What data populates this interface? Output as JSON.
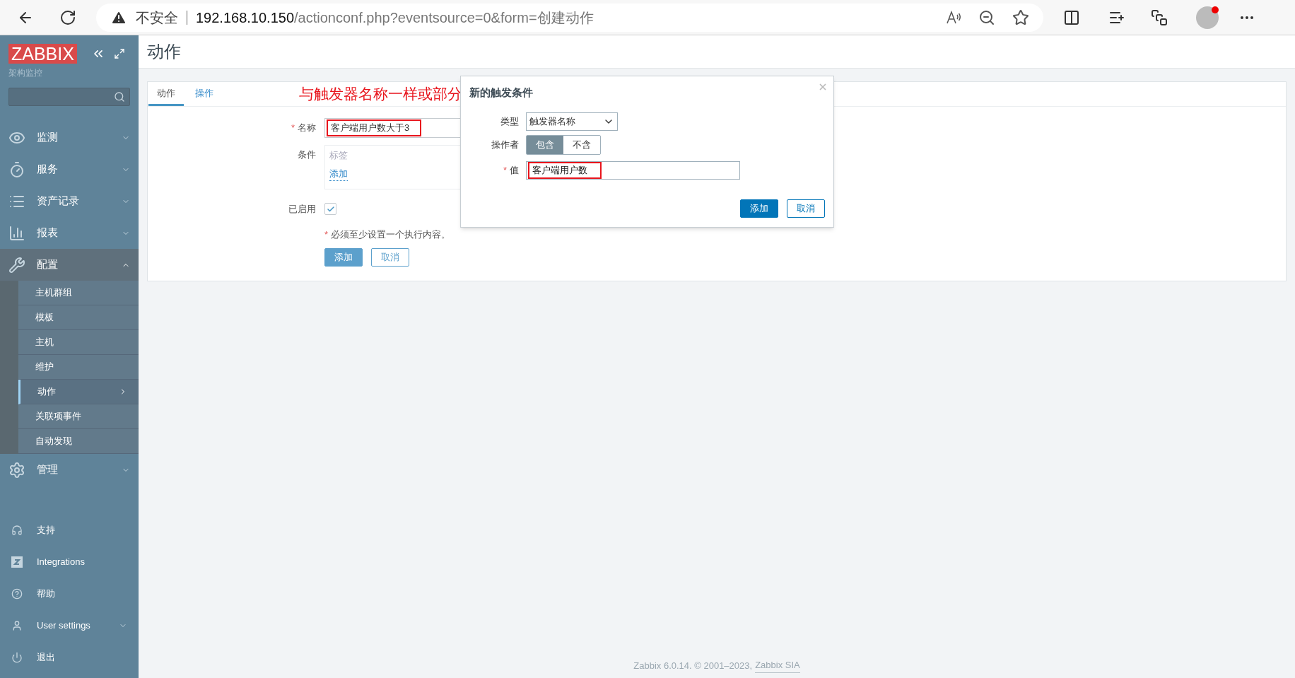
{
  "browser": {
    "warning": "不安全",
    "url_host": "192.168.10.150",
    "url_path": "/actionconf.php?eventsource=0&form=创建动作"
  },
  "sidebar": {
    "logo": "ZABBIX",
    "subtitle": "架构监控",
    "menu": [
      {
        "label": "监测",
        "expanded": false
      },
      {
        "label": "服务",
        "expanded": false
      },
      {
        "label": "资产记录",
        "expanded": false
      },
      {
        "label": "报表",
        "expanded": false
      },
      {
        "label": "配置",
        "expanded": true,
        "children": [
          {
            "label": "主机群组",
            "selected": false
          },
          {
            "label": "模板",
            "selected": false
          },
          {
            "label": "主机",
            "selected": false
          },
          {
            "label": "维护",
            "selected": false
          },
          {
            "label": "动作",
            "selected": true
          },
          {
            "label": "关联项事件",
            "selected": false
          },
          {
            "label": "自动发现",
            "selected": false
          }
        ]
      },
      {
        "label": "管理",
        "expanded": false
      }
    ],
    "bottom": [
      {
        "label": "支持",
        "kind": "link"
      },
      {
        "label": "Integrations",
        "kind": "link"
      },
      {
        "label": "帮助",
        "kind": "link"
      },
      {
        "label": "User settings",
        "kind": "group",
        "expanded": false
      },
      {
        "label": "退出",
        "kind": "link"
      }
    ]
  },
  "page_title": "动作",
  "tabs": [
    {
      "label": "动作",
      "selected": true
    },
    {
      "label": "操作",
      "selected": false
    }
  ],
  "annotation": "与触发器名称一样或部分",
  "form": {
    "name_label": "名称",
    "name_marker": "*",
    "name_value": "客户端用户数大于3",
    "name_annotated": true,
    "conditions_label": "条件",
    "conditions_header": "标签",
    "conditions_add": "添加",
    "enabled_label": "已启用",
    "enabled_checked": true,
    "note_marker": "*",
    "note": "必须至少设置一个执行内容。",
    "buttons": [
      {
        "label": "添加",
        "primary": true
      },
      {
        "label": "取消",
        "primary": false
      }
    ]
  },
  "dialog": {
    "title": "新的触发条件",
    "type_label": "类型",
    "type_value": "触发器名称",
    "operator_label": "操作者",
    "operators": [
      {
        "label": "包含",
        "selected": true
      },
      {
        "label": "不含",
        "selected": false
      }
    ],
    "value_label": "值",
    "value_marker": "*",
    "value": "客户端用户数",
    "value_annotated": true,
    "buttons": [
      {
        "label": "添加",
        "primary": true
      },
      {
        "label": "取消",
        "primary": false
      }
    ]
  },
  "footer": {
    "text": "Zabbix 6.0.14. © 2001–2023,",
    "link": "Zabbix SIA"
  }
}
